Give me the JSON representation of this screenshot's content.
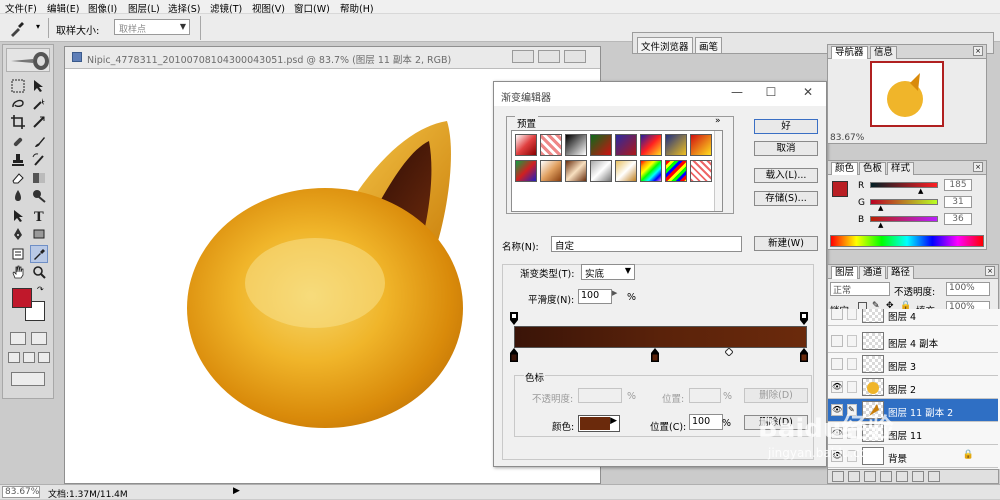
{
  "menu": [
    "文件(F)",
    "编辑(E)",
    "图像(I)",
    "图层(L)",
    "选择(S)",
    "滤镜(T)",
    "视图(V)",
    "窗口(W)",
    "帮助(H)"
  ],
  "options": {
    "sample_size_label": "取样大小:",
    "sample_size_value": "取样点",
    "well_tabs": [
      "文件浏览器",
      "画笔"
    ]
  },
  "document": {
    "title": "Nipic_4778311_20100708104300043051.psd @ 83.7% (图层 11 副本 2, RGB)"
  },
  "status": {
    "zoom": "83.67%",
    "doc_info": "文档:1.37M/11.4M"
  },
  "gradient_editor": {
    "title": "渐变编辑器",
    "presets_label": "预置",
    "presets_more": "»",
    "buttons": {
      "ok": "好",
      "cancel": "取消",
      "load": "载入(L)...",
      "save": "存储(S)...",
      "new": "新建(W)",
      "delete_opacity": "删除(D)",
      "delete_color": "删除(D)"
    },
    "name_label": "名称(N):",
    "name_value": "自定",
    "type_label": "渐变类型(T):",
    "type_value": "实底",
    "smoothness_label": "平滑度(N):",
    "smoothness_value": "100",
    "smoothness_unit": "%",
    "stops_label": "色标",
    "opacity_label": "不透明度:",
    "opacity_unit": "%",
    "location_dim_label": "位置:",
    "location_dim_unit": "%",
    "color_label": "颜色:",
    "location_label": "位置(C):",
    "location_value": "100",
    "location_unit": "%",
    "bar_colors": [
      "#3a1408",
      "#5a220a"
    ],
    "selected_color": "#6b2a0c"
  },
  "navigator": {
    "tabs": [
      "导航器",
      "信息"
    ],
    "zoom": "83.67%"
  },
  "color_panel": {
    "tabs": [
      "颜色",
      "色板",
      "样式"
    ],
    "r_label": "R",
    "r_value": "185",
    "g_label": "G",
    "g_value": "31",
    "b_label": "B",
    "b_value": "36",
    "swatch": "#b91f24"
  },
  "layers_panel": {
    "tabs": [
      "图层",
      "通道",
      "路径"
    ],
    "blend_mode": "正常",
    "opacity_label": "不透明度:",
    "opacity_value": "100%",
    "lock_label": "锁定:",
    "fill_label": "填充:",
    "fill_value": "100%",
    "layers": [
      {
        "name": "图层 4",
        "visible": false
      },
      {
        "name": "图层 4 副本",
        "visible": false
      },
      {
        "name": "图层 3",
        "visible": false
      },
      {
        "name": "图层 2",
        "visible": true
      },
      {
        "name": "图层 11 副本 2",
        "visible": true,
        "selected": true
      },
      {
        "name": "图层 11",
        "visible": true
      },
      {
        "name": "背景",
        "visible": true
      }
    ]
  },
  "watermark": {
    "text": "Baidu经验",
    "url": "jingyan.baidu.com"
  }
}
